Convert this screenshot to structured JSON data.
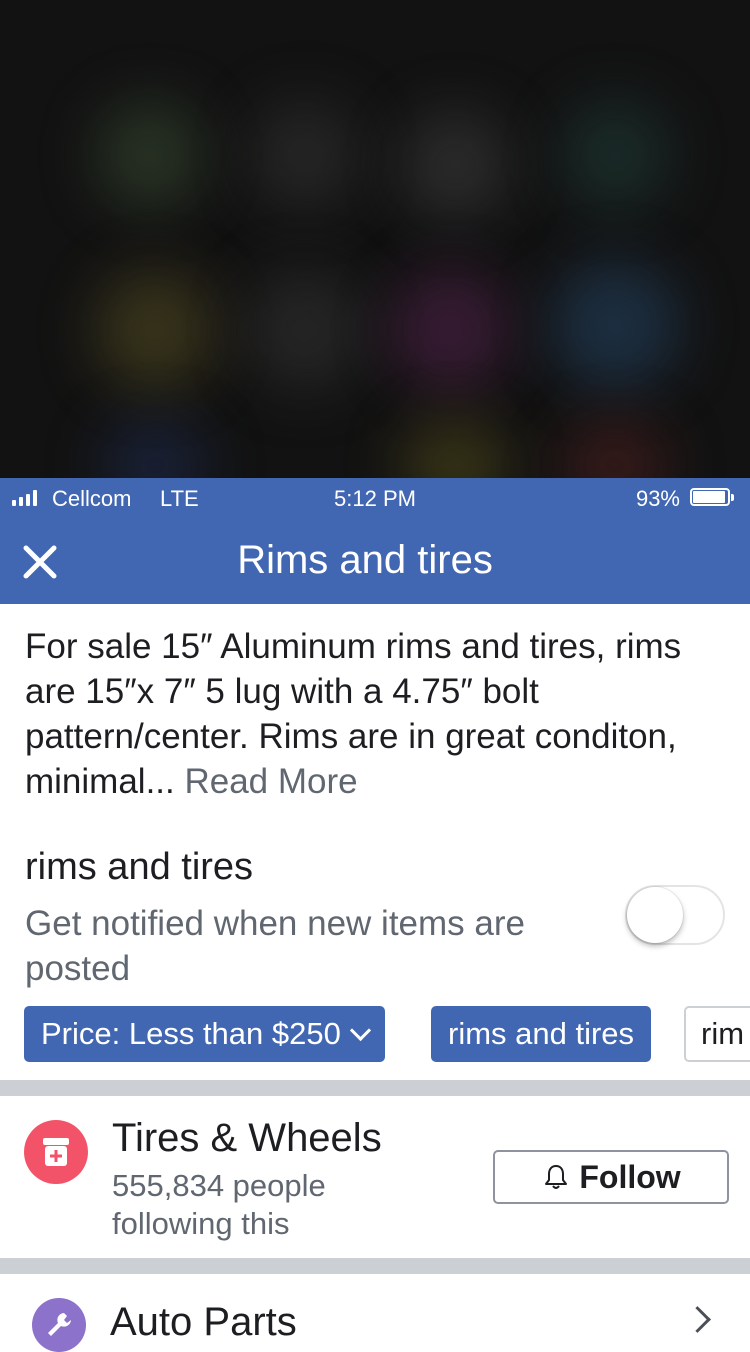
{
  "status_bar": {
    "carrier": "Cellcom",
    "network": "LTE",
    "time": "5:12 PM",
    "battery_percent_label": "93%",
    "battery_level": 0.93
  },
  "header": {
    "title": "Rims and tires",
    "close_icon": "close-icon"
  },
  "listing": {
    "description": "For sale 15″ Aluminum rims and tires, rims are 15″x 7″ 5 lug with a 4.75″ bolt pattern/center. Rims are in great conditon, minimal... ",
    "read_more": "Read More"
  },
  "saved_search": {
    "title": "rims and tires",
    "notify_text": "Get notified when new items are posted",
    "notify_enabled": false
  },
  "filters": {
    "price_chip": "Price: Less than $250",
    "query_chip": "rims and tires",
    "partial_chip": "rim"
  },
  "categories": [
    {
      "title": "Tires & Wheels",
      "followers": "555,834 people following this",
      "follow_label": "Follow",
      "icon": "tire-shop-icon",
      "icon_color": "#f35369"
    },
    {
      "title": "Auto Parts",
      "icon": "wrench-icon",
      "icon_color": "#8c72cb"
    }
  ],
  "colors": {
    "brand_blue": "#4267b2",
    "text_primary": "#1c1e21",
    "text_secondary": "#606770"
  }
}
